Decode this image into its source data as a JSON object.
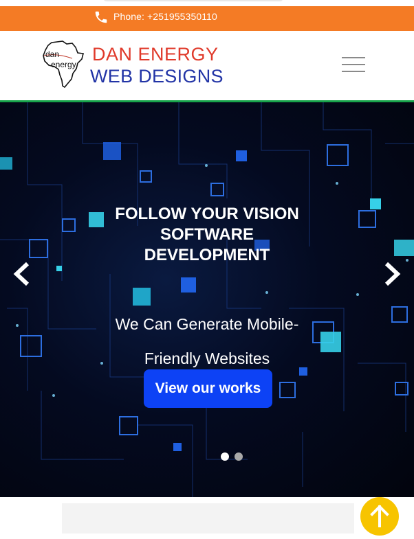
{
  "contact": {
    "phone_text": "Phone: +251955350110",
    "phone_icon": "phone-icon"
  },
  "brand": {
    "map_text_top": "dan",
    "map_text_bottom": "energy",
    "line1": "DAN ENERGY",
    "line2": "WEB DESIGNS",
    "line1_color": "#e03a2b",
    "line2_color": "#2234a6"
  },
  "nav": {
    "menu_icon": "hamburger-menu-icon"
  },
  "hero": {
    "title_lines": [
      "FOLLOW YOUR VISION",
      "SOFTWARE",
      "DEVELOPMENT"
    ],
    "subtitle_lines": [
      "We Can Generate Mobile-",
      "Friendly Websites"
    ],
    "cta_label": "View our works",
    "prev_icon": "chevron-left-icon",
    "next_icon": "chevron-right-icon",
    "slides_total": 2,
    "active_slide": 1
  },
  "colors": {
    "topbar": "#f47b25",
    "header_border": "#17a34a",
    "cta": "#0d42f5",
    "back_to_top": "#f7c400"
  },
  "back_to_top": {
    "icon": "arrow-up-icon"
  }
}
